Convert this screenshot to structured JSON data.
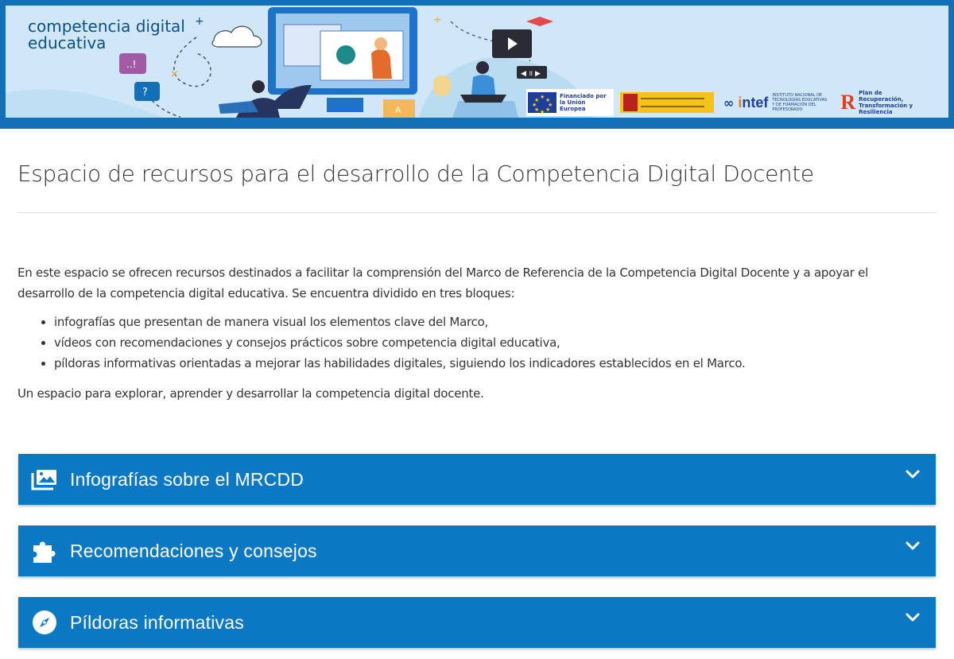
{
  "banner": {
    "brand_line1": "competencia digital",
    "brand_line2": "educativa",
    "brand_plus": "+",
    "eu_logo_text": "Financiado por la Unión Europea",
    "intef_name_prefix": "i",
    "intef_name_suffix": "ntef",
    "intef_text": "INSTITUTO NACIONAL DE TECNOLOGÍAS EDUCATIVAS Y DE FORMACIÓN DEL PROFESORADO",
    "prtr_text": "Plan de Recuperación, Transformación y Resiliencia"
  },
  "page": {
    "title": "Espacio de recursos para el desarrollo de la Competencia Digital Docente",
    "intro": "En este espacio se ofrecen recursos destinados a facilitar la comprensión del Marco de Referencia de la Competencia Digital Docente y a apoyar el desarrollo de la competencia digital educativa. Se encuentra dividido en tres bloques:",
    "bullets": [
      "infografías que presentan de manera visual los elementos clave del Marco,",
      "vídeos con recomendaciones y consejos prácticos sobre competencia digital educativa,",
      "píldoras informativas orientadas a mejorar las habilidades digitales, siguiendo los indicadores establecidos en el Marco."
    ],
    "closing": "Un espacio para explorar, aprender y desarrollar la competencia digital docente."
  },
  "accordions": [
    {
      "label": "Infografías sobre el MRCDD",
      "icon": "images-icon"
    },
    {
      "label": "Recomendaciones y consejos",
      "icon": "puzzle-piece-icon"
    },
    {
      "label": "Píldoras informativas",
      "icon": "compass-icon"
    }
  ],
  "colors": {
    "banner_border": "#1470b6",
    "banner_bg": "#cfe7f7",
    "accordion_bg": "#0b78c4",
    "text": "#333333"
  }
}
